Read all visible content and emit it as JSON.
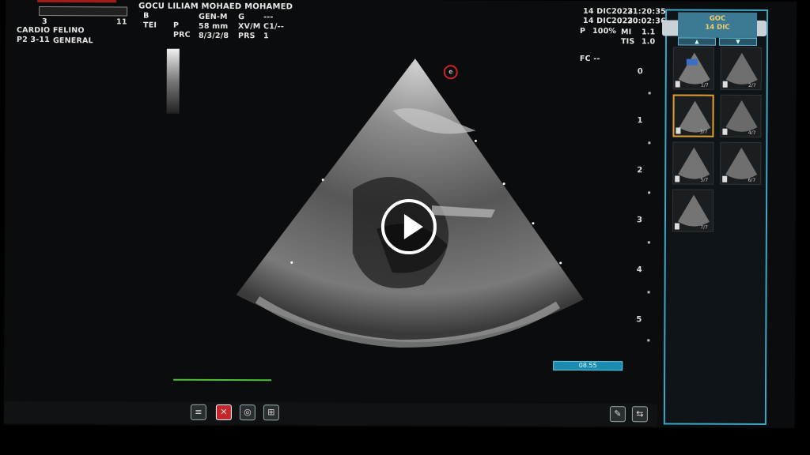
{
  "header": {
    "patient_name": "GOCU LILIAM MOHAED MOHAMED",
    "exam": "CARDIO FELINO",
    "probe": "P2 3-11",
    "preset": "GENERAL",
    "scale_min": "3",
    "scale_max": "11",
    "col1": [
      "B",
      "TEI"
    ],
    "col2_label": [
      "P",
      "PRC"
    ],
    "col3": [
      "GEN-M",
      "58 mm",
      "8/3/2/8"
    ],
    "col4_label": [
      "G",
      "XV/M",
      "PRS"
    ],
    "col5": [
      "---",
      "C1/--",
      "1"
    ],
    "date1": "14 DIC",
    "year1": "2023",
    "time1": "21:20:35",
    "date2": "14 DIC",
    "year2": "2023",
    "time2": "20:02:36",
    "p_label": "P",
    "power": "100%",
    "mi_label": "MI",
    "mi": "1.1",
    "tis_label": "TIS",
    "tis": "1.0",
    "fc": "FC --"
  },
  "depth_scale": [
    "0",
    "1",
    "2",
    "3",
    "4",
    "5"
  ],
  "marker": "e",
  "cine_progress": "08.55",
  "cine_fraction": 1.0,
  "sidebar": {
    "title": "GOC",
    "date": "14 DIC",
    "up": "▲",
    "down": "▼",
    "thumbnails": [
      {
        "label": "1/7",
        "selected": false
      },
      {
        "label": "2/7",
        "selected": false
      },
      {
        "label": "3/7",
        "selected": true
      },
      {
        "label": "4/7",
        "selected": false
      },
      {
        "label": "5/7",
        "selected": false
      },
      {
        "label": "6/7",
        "selected": false
      },
      {
        "label": "7/7",
        "selected": false
      }
    ]
  },
  "toolbar": {
    "icons": [
      "list-icon",
      "delete-icon",
      "target-icon",
      "network-icon",
      "edit-icon",
      "export-icon"
    ]
  },
  "colors": {
    "accent": "#3ea7c4",
    "selected": "#e0a030",
    "ecg": "#4fbf3b",
    "delete": "#c4262b"
  }
}
